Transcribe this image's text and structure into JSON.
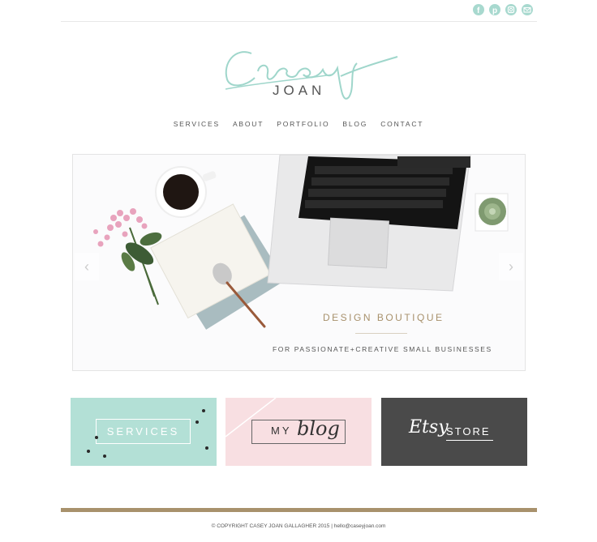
{
  "header": {
    "logo_script": "Casey",
    "logo_name": "JOAN",
    "social_icons": [
      "facebook-icon",
      "pinterest-icon",
      "instagram-icon",
      "email-icon"
    ],
    "accent_color": "#a8d9cf"
  },
  "nav": {
    "items": [
      "SERVICES",
      "ABOUT",
      "PORTFOLIO",
      "BLOG",
      "CONTACT"
    ]
  },
  "hero": {
    "title": "DESIGN BOUTIQUE",
    "subtitle": "FOR PASSIONATE+CREATIVE SMALL BUSINESSES",
    "prev_arrow": "‹",
    "next_arrow": "›"
  },
  "boxes": {
    "services": {
      "label": "SERVICES",
      "color": "#b3e0d6"
    },
    "blog": {
      "label_my": "MY",
      "label_blog": "blog",
      "color": "#f8dfe2"
    },
    "etsy": {
      "label_etsy": "Etsy",
      "label_store": "STORE",
      "color": "#4a4a4a"
    }
  },
  "footer": {
    "text": "© COPYRIGHT CASEY JOAN GALLAGHER 2015  |  hello@caseyjoan.com",
    "bar_color": "#a8916c"
  }
}
